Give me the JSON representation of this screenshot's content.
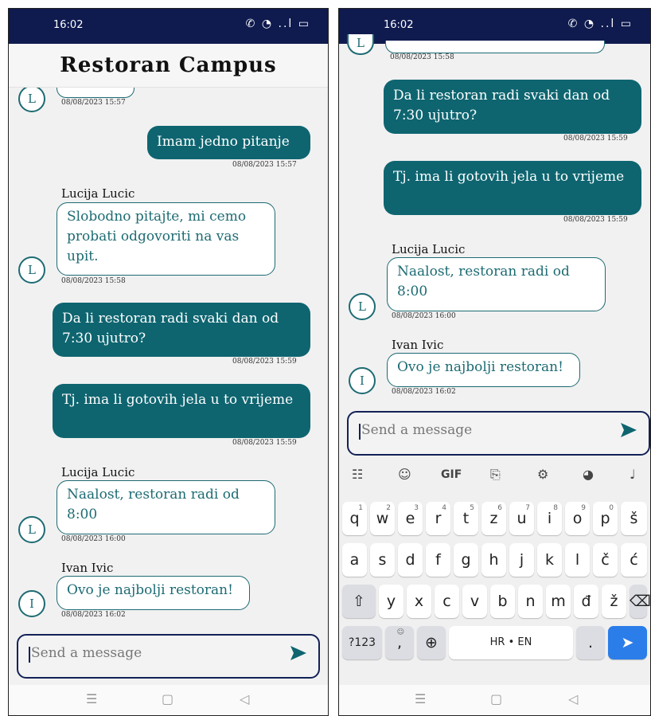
{
  "left": {
    "status_time": "16:02",
    "status_icons": "✆ ◔ ..l ▭",
    "title": "Restoran Campus",
    "top_stamp": "08/08/2023 15:57",
    "top_avatar": "L",
    "msg1": {
      "text": "Imam jedno pitanje",
      "time": "08/08/2023 15:57"
    },
    "msg2": {
      "sender": "Lucija Lucic",
      "text": "Slobodno pitajte, mi cemo probati odgovoriti na vas upit.",
      "time": "08/08/2023 15:58",
      "avatar": "L"
    },
    "msg3": {
      "text": "Da li restoran radi svaki dan od 7:30 ujutro?",
      "time": "08/08/2023 15:59"
    },
    "msg4": {
      "text": "Tj. ima li gotovih jela u to vrijeme",
      "time": "08/08/2023 15:59"
    },
    "msg5": {
      "sender": "Lucija Lucic",
      "text": "Naalost, restoran radi od 8:00",
      "time": "08/08/2023 16:00",
      "avatar": "L"
    },
    "msg6": {
      "sender": "Ivan Ivic",
      "text": "Ovo je najbolji restoran!",
      "time": "08/08/2023 16:02",
      "avatar": "I"
    },
    "input_placeholder": "Send a message",
    "nav": [
      "☰",
      "▢",
      "◁"
    ]
  },
  "right": {
    "status_time": "16:02",
    "status_icons": "✆ ◔ ..l ▭",
    "top_stamp": "08/08/2023 15:58",
    "top_avatar": "L",
    "msg3": {
      "text": "Da li restoran radi svaki dan od 7:30 ujutro?",
      "time": "08/08/2023 15:59"
    },
    "msg4": {
      "text": "Tj. ima li gotovih jela u to vrijeme",
      "time": "08/08/2023 15:59"
    },
    "msg5": {
      "sender": "Lucija Lucic",
      "text": "Naalost, restoran radi od 8:00",
      "time": "08/08/2023 16:00",
      "avatar": "L"
    },
    "msg6": {
      "sender": "Ivan Ivic",
      "text": "Ovo je najbolji restoran!",
      "time": "08/08/2023 16:02",
      "avatar": "I"
    },
    "input_placeholder": "Send a message",
    "keyboard": {
      "toolbar": [
        "☷",
        "☺",
        "GIF",
        "⎘",
        "⚙",
        "◕",
        "♩"
      ],
      "row1": [
        "q",
        "w",
        "e",
        "r",
        "t",
        "z",
        "u",
        "i",
        "o",
        "p",
        "š"
      ],
      "row1_hints": [
        "1",
        "2",
        "3",
        "4",
        "5",
        "6",
        "7",
        "8",
        "9",
        "0",
        ""
      ],
      "row2": [
        "a",
        "s",
        "d",
        "f",
        "g",
        "h",
        "j",
        "k",
        "l",
        "č",
        "ć"
      ],
      "row3": [
        "y",
        "x",
        "c",
        "v",
        "b",
        "n",
        "m",
        "đ",
        "ž"
      ],
      "shift": "⇧",
      "backspace": "⌫",
      "symbols": "?123",
      "emoji": "☺",
      "comma": ",",
      "globe": "⊕",
      "space": "HR • EN",
      "period": ".",
      "enter": "➤"
    },
    "nav": [
      "☰",
      "▢",
      "◁"
    ]
  },
  "colors": {
    "header_bg": "#0f1b4f",
    "bubble_out": "#0e6570",
    "bubble_in_border": "#1d6b73",
    "input_border": "#132257",
    "enter_key": "#2b7de9"
  }
}
